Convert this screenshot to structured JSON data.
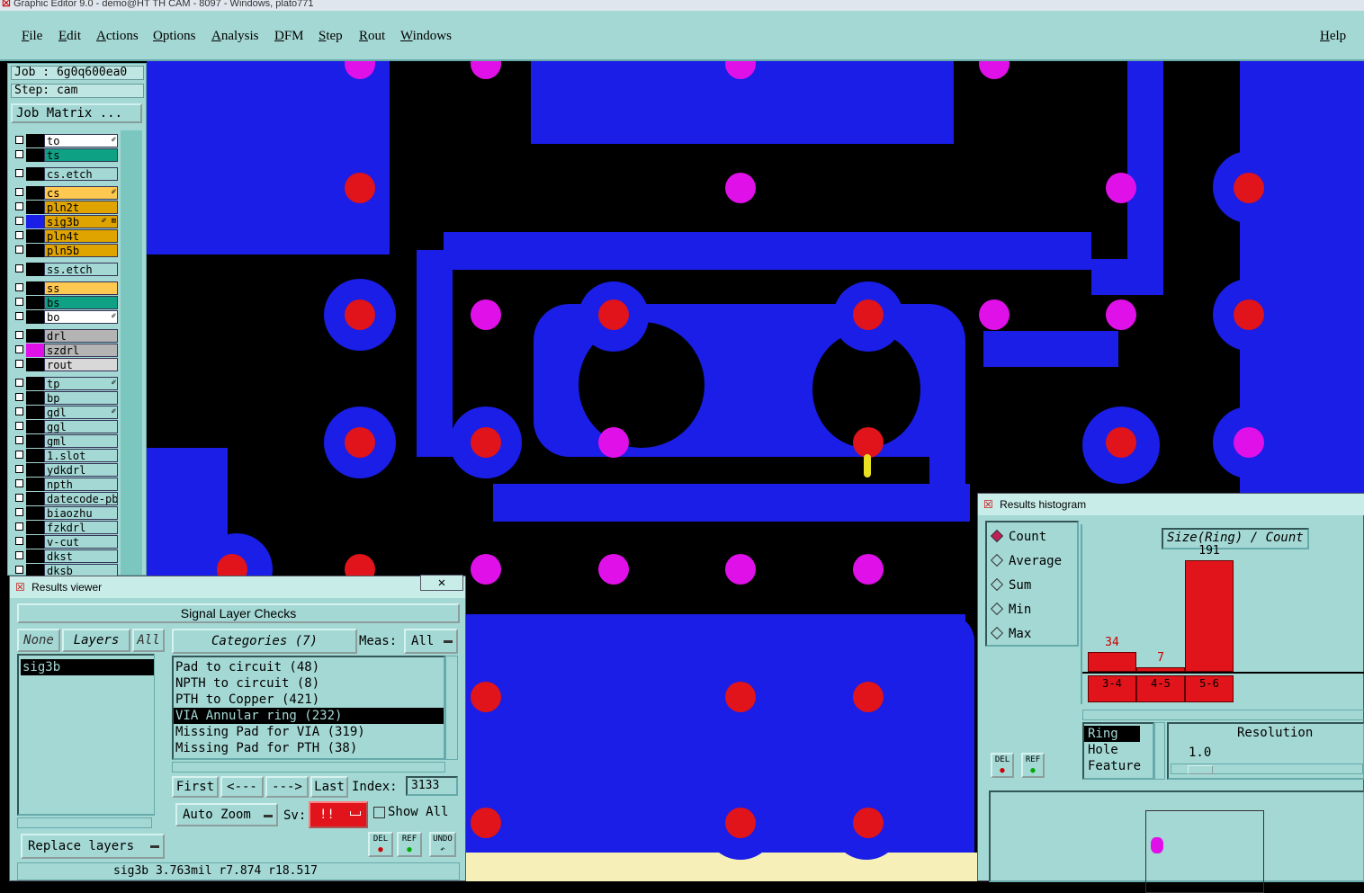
{
  "window": {
    "title": "Graphic Editor 9.0 - demo@HT TH CAM - 8097 - Windows, plato771"
  },
  "menu": {
    "items": [
      "File",
      "Edit",
      "Actions",
      "Options",
      "Analysis",
      "DFM",
      "Step",
      "Rout",
      "Windows"
    ],
    "help": "Help"
  },
  "job": {
    "job_label": "Job : 6g0q600ea0",
    "step_label": "Step: cam",
    "matrix_button": "Job Matrix ..."
  },
  "layers": [
    {
      "name": "to",
      "color": "#ffffff",
      "swatch": "#000000",
      "flag": "✐"
    },
    {
      "name": "ts",
      "color": "#0fa184",
      "swatch": "#000000",
      "flag": ""
    },
    {
      "name": "cs.etch",
      "color": "#a4d8d4",
      "swatch": "#000000",
      "flag": ""
    },
    {
      "name": "cs",
      "color": "#ffc850",
      "swatch": "#000000",
      "flag": "✐"
    },
    {
      "name": "pln2t",
      "color": "#e0a400",
      "swatch": "#000000",
      "flag": ""
    },
    {
      "name": "sig3b",
      "color": "#e0a400",
      "swatch": "#1a1ee6",
      "flag": "✐ ⊠"
    },
    {
      "name": "pln4t",
      "color": "#e0a400",
      "swatch": "#000000",
      "flag": ""
    },
    {
      "name": "pln5b",
      "color": "#e0a400",
      "swatch": "#000000",
      "flag": ""
    },
    {
      "name": "ss.etch",
      "color": "#a4d8d4",
      "swatch": "#000000",
      "flag": ""
    },
    {
      "name": "ss",
      "color": "#ffc850",
      "swatch": "#000000",
      "flag": ""
    },
    {
      "name": "bs",
      "color": "#0fa184",
      "swatch": "#000000",
      "flag": ""
    },
    {
      "name": "bo",
      "color": "#ffffff",
      "swatch": "#000000",
      "flag": "✐"
    },
    {
      "name": "drl",
      "color": "#b4b4b4",
      "swatch": "#000000",
      "flag": ""
    },
    {
      "name": "szdrl",
      "color": "#b4b4b4",
      "swatch": "#e010e8",
      "flag": ""
    },
    {
      "name": "rout",
      "color": "#d8d8d8",
      "swatch": "#000000",
      "flag": ""
    },
    {
      "name": "tp",
      "color": "#a4d8d4",
      "swatch": "#000000",
      "flag": "✐"
    },
    {
      "name": "bp",
      "color": "#a4d8d4",
      "swatch": "#000000",
      "flag": ""
    },
    {
      "name": "gdl",
      "color": "#a4d8d4",
      "swatch": "#000000",
      "flag": "✐"
    },
    {
      "name": "ggl",
      "color": "#a4d8d4",
      "swatch": "#000000",
      "flag": ""
    },
    {
      "name": "gml",
      "color": "#a4d8d4",
      "swatch": "#000000",
      "flag": ""
    },
    {
      "name": "1.slot",
      "color": "#a4d8d4",
      "swatch": "#000000",
      "flag": ""
    },
    {
      "name": "ydkdrl",
      "color": "#a4d8d4",
      "swatch": "#000000",
      "flag": ""
    },
    {
      "name": "npth",
      "color": "#a4d8d4",
      "swatch": "#000000",
      "flag": ""
    },
    {
      "name": "datecode-pbe",
      "color": "#a4d8d4",
      "swatch": "#000000",
      "flag": ""
    },
    {
      "name": "biaozhu",
      "color": "#a4d8d4",
      "swatch": "#000000",
      "flag": ""
    },
    {
      "name": "fzkdrl",
      "color": "#a4d8d4",
      "swatch": "#000000",
      "flag": ""
    },
    {
      "name": "v-cut",
      "color": "#a4d8d4",
      "swatch": "#000000",
      "flag": ""
    },
    {
      "name": "dkst",
      "color": "#a4d8d4",
      "swatch": "#000000",
      "flag": ""
    },
    {
      "name": "dksb",
      "color": "#a4d8d4",
      "swatch": "#000000",
      "flag": ""
    }
  ],
  "results_viewer": {
    "title": "Results viewer",
    "header": "Signal Layer Checks",
    "none_btn": "None",
    "layers_btn": "Layers",
    "all_btn": "All",
    "layer_list": [
      "sig3b"
    ],
    "categories_btn": "Categories (7)",
    "meas_label": "Meas:",
    "meas_value": "All",
    "categories": [
      "Pad to circuit (48)",
      "NPTH to circuit (8)",
      "PTH to Copper (421)",
      "VIA Annular ring (232)",
      "Missing Pad for VIA (319)",
      "Missing Pad for PTH (38)"
    ],
    "selected_category_index": 3,
    "first": "First",
    "prev": "<---",
    "next": "--->",
    "last": "Last",
    "index_label": "Index:",
    "index_value": "3133",
    "zoom": "Auto Zoom",
    "sv_label": "Sv:",
    "sv_value": "!!",
    "show_all": "Show All",
    "del": "DEL",
    "ref": "REF",
    "undo": "UNDO",
    "replace": "Replace layers",
    "status": "sig3b 3.763mil  r7.874  r18.517"
  },
  "histogram": {
    "title": "Results histogram",
    "modes": [
      "Count",
      "Average",
      "Sum",
      "Min",
      "Max"
    ],
    "selected_mode": "Count",
    "chart_title": "Size(Ring) / Count",
    "del": "DEL",
    "ref": "REF",
    "list": [
      "Ring",
      "Hole",
      "Feature"
    ],
    "resolution_label": "Resolution",
    "resolution_value": "1.0"
  },
  "chart_data": {
    "type": "bar",
    "title": "Size(Ring) / Count",
    "categories": [
      "3-4",
      "4-5",
      "5-6"
    ],
    "values": [
      34,
      7,
      191
    ]
  }
}
